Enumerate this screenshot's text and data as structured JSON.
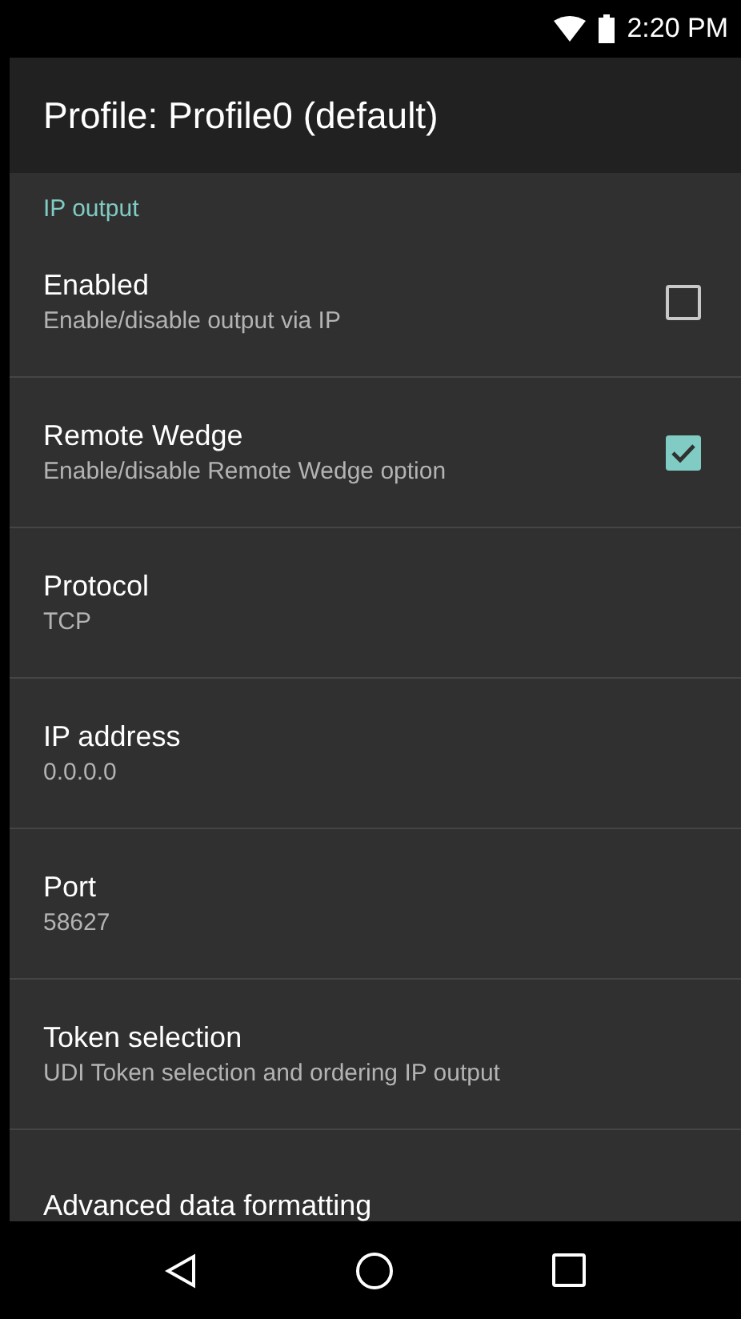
{
  "status_bar": {
    "time": "2:20 PM"
  },
  "toolbar": {
    "title": "Profile: Profile0 (default)"
  },
  "section": {
    "title": "IP output"
  },
  "items": [
    {
      "kind": "checkbox",
      "title": "Enabled",
      "summary": "Enable/disable output via IP",
      "checked": false
    },
    {
      "kind": "checkbox",
      "title": "Remote Wedge",
      "summary": "Enable/disable Remote Wedge option",
      "checked": true
    },
    {
      "kind": "text",
      "title": "Protocol",
      "summary": "TCP"
    },
    {
      "kind": "text",
      "title": "IP address",
      "summary": "0.0.0.0"
    },
    {
      "kind": "text",
      "title": "Port",
      "summary": "58627"
    },
    {
      "kind": "text",
      "title": "Token selection",
      "summary": "UDI Token selection and ordering IP output"
    },
    {
      "kind": "text",
      "title": "Advanced data formatting"
    }
  ]
}
